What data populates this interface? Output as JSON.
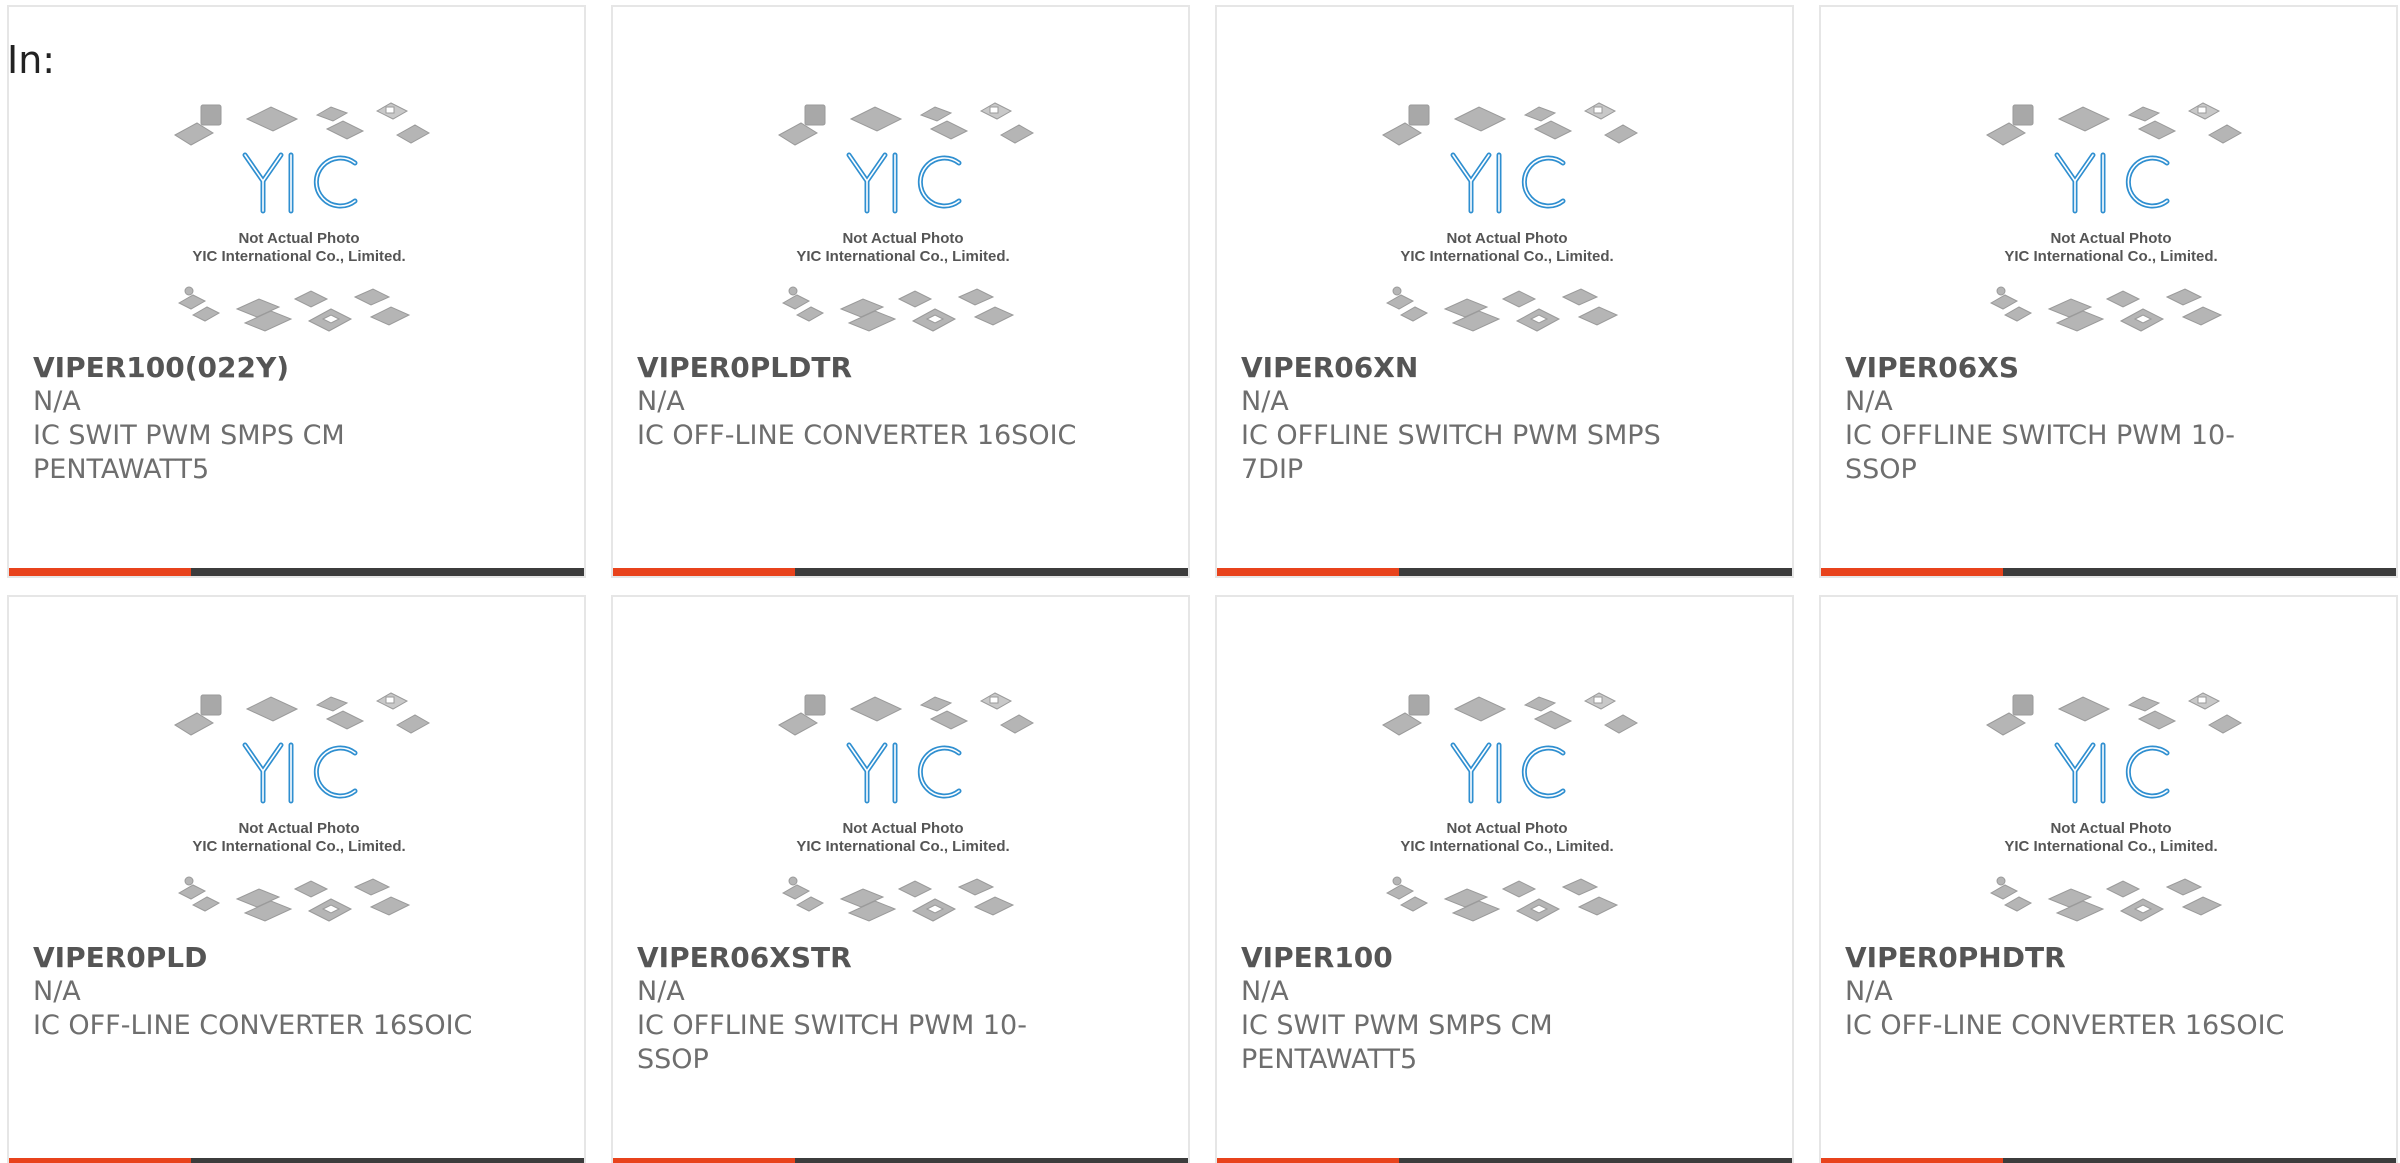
{
  "heading": "In:",
  "accent_color": "#e8431c",
  "bar_color": "#3c3c3c",
  "photo_caption_line1": "Not Actual Photo",
  "photo_caption_line2": "YIC International Co., Limited.",
  "photo_logo": "YIC",
  "products": [
    {
      "part": "VIPER100(022Y)",
      "manufacturer": "N/A",
      "description": "IC SWIT PWM SMPS CM PENTAWATT5"
    },
    {
      "part": "VIPER0PLDTR",
      "manufacturer": "N/A",
      "description": "IC OFF-LINE CONVERTER 16SOIC"
    },
    {
      "part": "VIPER06XN",
      "manufacturer": "N/A",
      "description": "IC OFFLINE SWITCH PWM SMPS 7DIP"
    },
    {
      "part": "VIPER06XS",
      "manufacturer": "N/A",
      "description": "IC OFFLINE SWITCH PWM 10-SSOP"
    },
    {
      "part": "VIPER0PLD",
      "manufacturer": "N/A",
      "description": "IC OFF-LINE CONVERTER 16SOIC"
    },
    {
      "part": "VIPER06XSTR",
      "manufacturer": "N/A",
      "description": "IC OFFLINE SWITCH PWM 10-SSOP"
    },
    {
      "part": "VIPER100",
      "manufacturer": "N/A",
      "description": "IC SWIT PWM SMPS CM PENTAWATT5"
    },
    {
      "part": "VIPER0PHDTR",
      "manufacturer": "N/A",
      "description": "IC OFF-LINE CONVERTER 16SOIC"
    }
  ]
}
